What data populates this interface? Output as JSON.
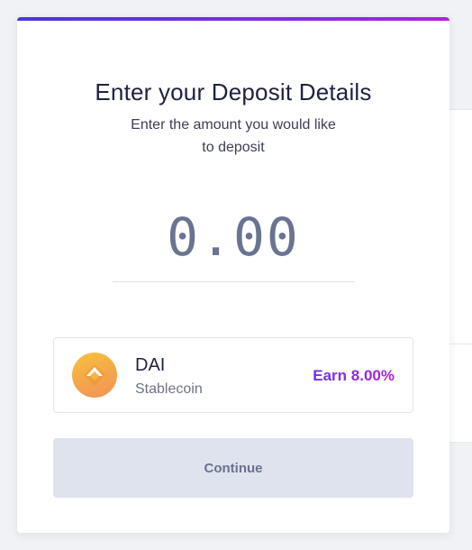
{
  "header": {
    "title": "Enter your Deposit Details",
    "subtitle": "Enter the amount you would like to deposit"
  },
  "amount": {
    "value": "0.00"
  },
  "asset": {
    "icon": "dai-coin-icon",
    "name": "DAI",
    "type": "Stablecoin",
    "earn_label": "Earn 8.00%"
  },
  "actions": {
    "continue_label": "Continue"
  },
  "colors": {
    "accent_start": "#4a35dd",
    "accent_end": "#b31fe0",
    "title": "#1e2240",
    "amount": "#6b7391",
    "button_bg": "#dfe3ee",
    "coin": "#f4a64a"
  }
}
